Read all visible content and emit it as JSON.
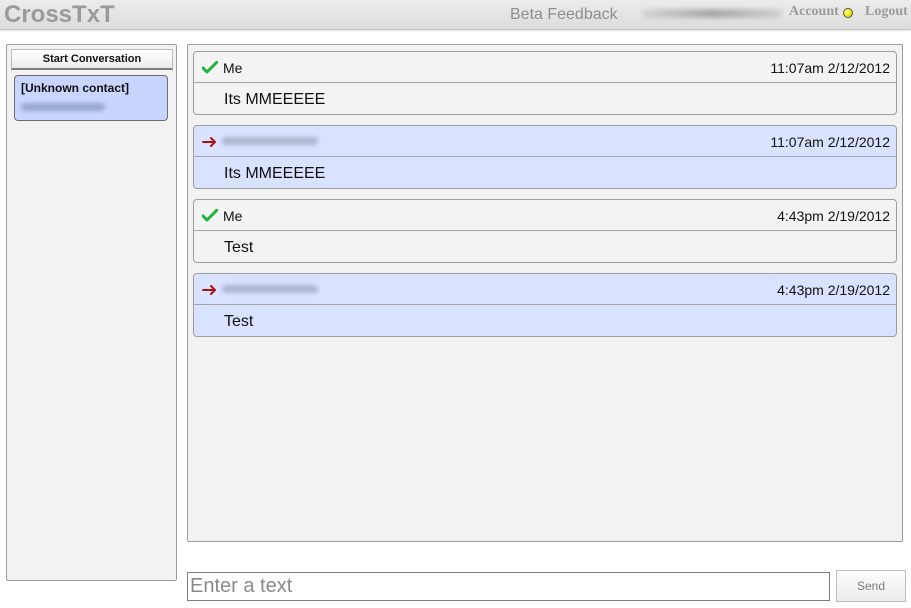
{
  "header": {
    "logo_text": "CrossTxT",
    "beta_feedback_label": "Beta Feedback",
    "account_label": "Account",
    "logout_label": "Logout",
    "status_color": "#e8e800"
  },
  "sidebar": {
    "start_conversation_label": "Start Conversation",
    "contacts": [
      {
        "name": "[Unknown contact]"
      }
    ]
  },
  "conversation": {
    "messages": [
      {
        "direction": "outgoing",
        "icon": "check-icon",
        "sender": "Me",
        "time": "11:07am 2/12/2012",
        "text": "Its MMEEEEE",
        "background": "#f3f3f3"
      },
      {
        "direction": "incoming",
        "icon": "arrow-right-icon",
        "sender": "",
        "time": "11:07am 2/12/2012",
        "text": "Its MMEEEEE",
        "background": "#d9e3ff"
      },
      {
        "direction": "outgoing",
        "icon": "check-icon",
        "sender": "Me",
        "time": "4:43pm 2/19/2012",
        "text": "Test",
        "background": "#f3f3f3"
      },
      {
        "direction": "incoming",
        "icon": "arrow-right-icon",
        "sender": "",
        "time": "4:43pm 2/19/2012",
        "text": "Test",
        "background": "#d9e3ff"
      }
    ]
  },
  "composer": {
    "placeholder": "Enter a text",
    "value": "",
    "send_label": "Send"
  }
}
